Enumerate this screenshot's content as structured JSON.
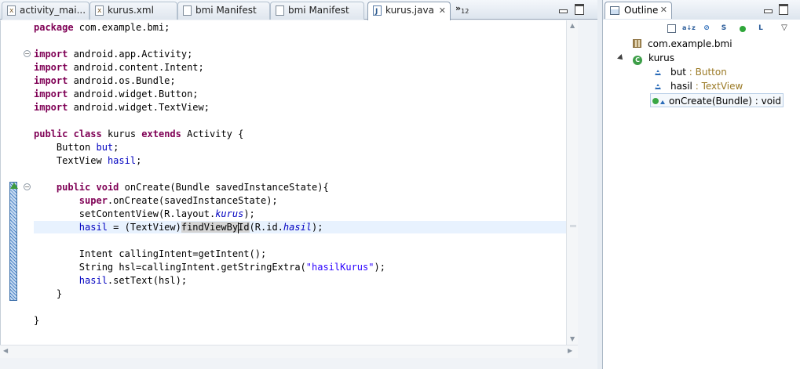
{
  "editor": {
    "tabs": [
      {
        "label": "activity_mai...",
        "icon": "xml-file-icon"
      },
      {
        "label": "kurus.xml",
        "icon": "xml-file-icon"
      },
      {
        "label": "bmi Manifest",
        "icon": "manifest-file-icon"
      },
      {
        "label": "bmi Manifest",
        "icon": "manifest-file-icon"
      },
      {
        "label": "kurus.java",
        "icon": "java-file-icon",
        "active": true
      }
    ],
    "close_glyph": "✕",
    "overflow": {
      "chevron": "»",
      "count": "12"
    },
    "code": {
      "l1": {
        "kw": "package",
        "rest": " com.example.bmi;"
      },
      "l3": {
        "kw": "import",
        "rest": " android.app.Activity;"
      },
      "l4": {
        "kw": "import",
        "rest": " android.content.Intent;"
      },
      "l5": {
        "kw": "import",
        "rest": " android.os.Bundle;"
      },
      "l6": {
        "kw": "import",
        "rest": " android.widget.Button;"
      },
      "l7": {
        "kw": "import",
        "rest": " android.widget.TextView;"
      },
      "l9": {
        "kw1": "public",
        "kw2": "class",
        "name": " kurus ",
        "kw3": "extends",
        "rest": " Activity {"
      },
      "l10": {
        "indent": "    ",
        "type": "Button ",
        "field": "but",
        "end": ";"
      },
      "l11": {
        "indent": "    ",
        "type": "TextView ",
        "field": "hasil",
        "end": ";"
      },
      "l13": {
        "indent": "    ",
        "kw1": "public",
        "kw2": "void",
        "rest": " onCreate(Bundle savedInstanceState){"
      },
      "l14": {
        "indent": "        ",
        "kw": "super",
        "rest": ".onCreate(savedInstanceState);"
      },
      "l15": {
        "indent": "        ",
        "pre": "setContentView(R.layout.",
        "ital": "kurus",
        "post": ");"
      },
      "l16": {
        "indent": "        ",
        "field": "hasil",
        "mid": " = (TextView)",
        "occ1": "findViewBy",
        "occ2": "Id",
        "pre2": "(R.id.",
        "ital": "hasil",
        "post": ");"
      },
      "l18": {
        "indent": "        ",
        "text": "Intent callingIntent=getIntent();"
      },
      "l19": {
        "indent": "        ",
        "pre": "String hsl=callingIntent.getStringExtra(",
        "str": "\"hasilKurus\"",
        "post": ");"
      },
      "l20": {
        "indent": "        ",
        "field": "hasil",
        "rest": ".setText(hsl);"
      },
      "l21": {
        "text": "    }"
      },
      "l23": {
        "text": "}"
      }
    }
  },
  "outline": {
    "title": "Outline",
    "toolbar": [
      "collapse-all-icon",
      "sort-az-icon",
      "hide-fields-icon",
      "hide-static-icon",
      "hide-nonpublic-icon",
      "hide-local-types-icon",
      "view-menu-icon"
    ],
    "toolbar_glyphs": {
      "sort": "a↓z",
      "static": "S",
      "local": "L"
    },
    "tree": {
      "package": "com.example.bmi",
      "class": "kurus",
      "class_badge": "C",
      "fields": [
        {
          "name": "but",
          "sep": " : ",
          "type": "Button"
        },
        {
          "name": "hasil",
          "sep": " : ",
          "type": "TextView"
        }
      ],
      "method": "onCreate(Bundle) : void"
    }
  }
}
